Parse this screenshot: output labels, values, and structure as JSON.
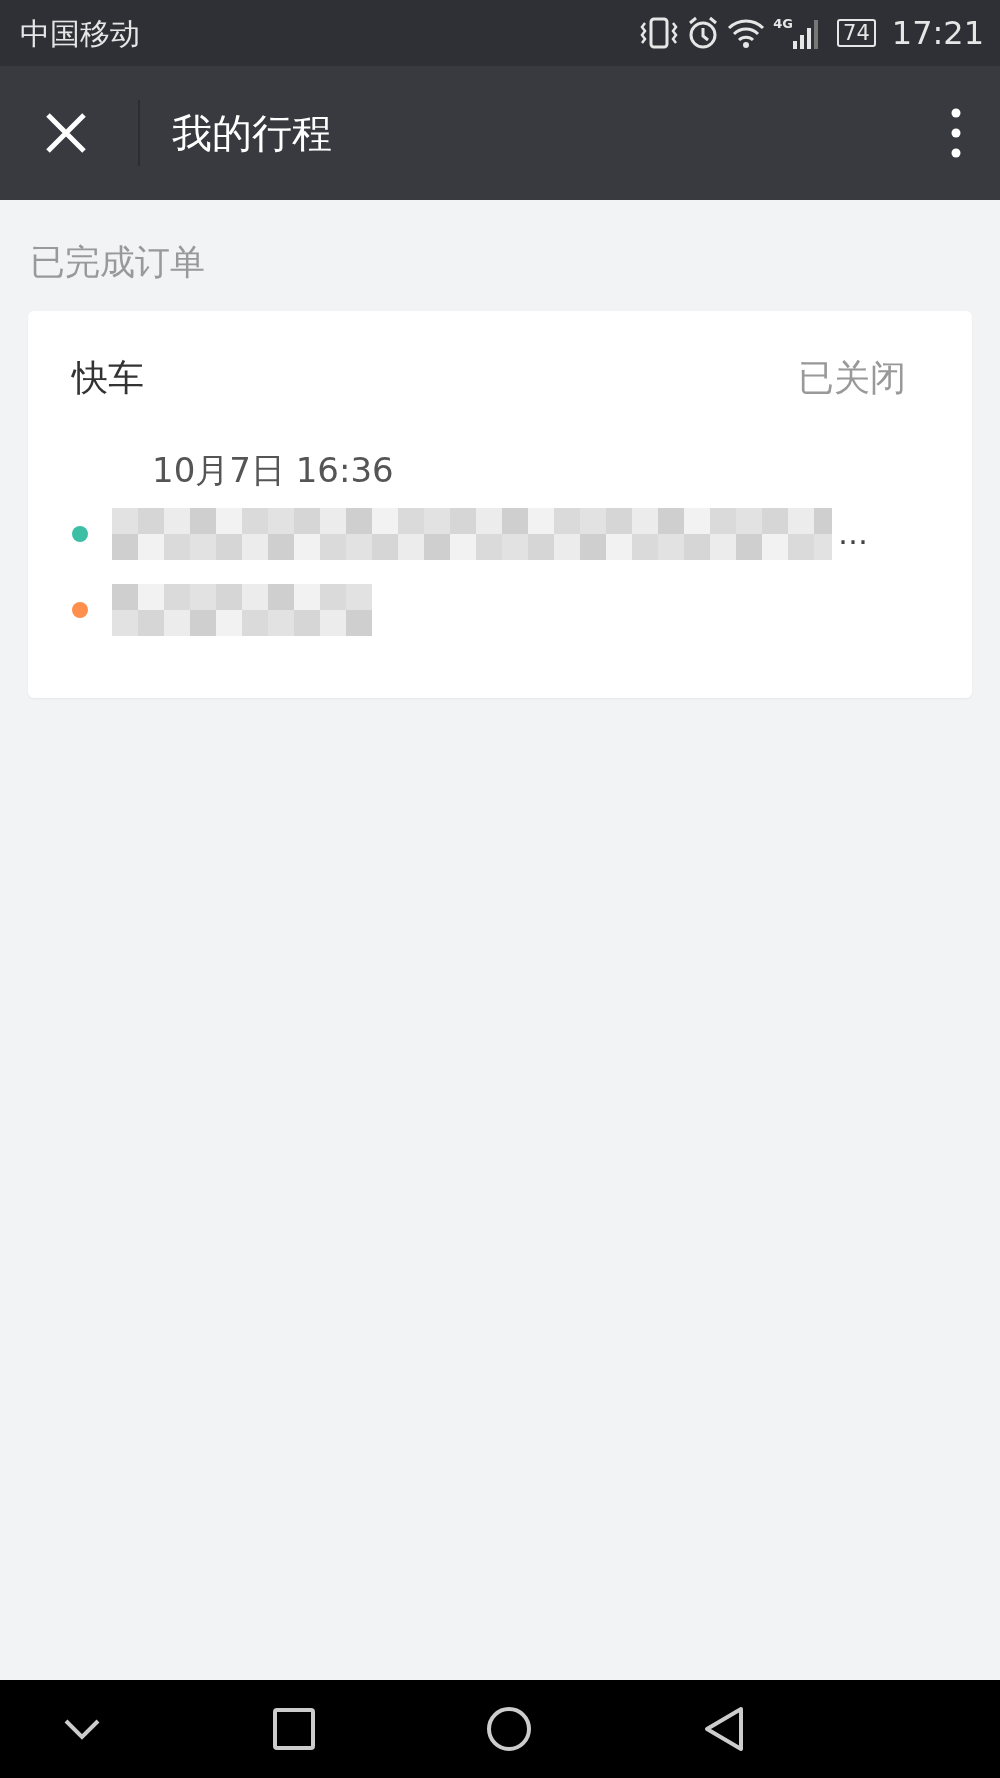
{
  "status_bar": {
    "carrier": "中国移动",
    "network": "4G",
    "battery": "74",
    "time": "17:21"
  },
  "nav_bar": {
    "title": "我的行程"
  },
  "section_title": "已完成订单",
  "orders": [
    {
      "type": "快车",
      "status": "已关闭",
      "time": "10月7日 16:36",
      "stops": [
        {
          "kind": "start",
          "color": "#3dbfa5",
          "tail": "…"
        },
        {
          "kind": "end",
          "color": "#ff8f4d"
        }
      ]
    }
  ]
}
